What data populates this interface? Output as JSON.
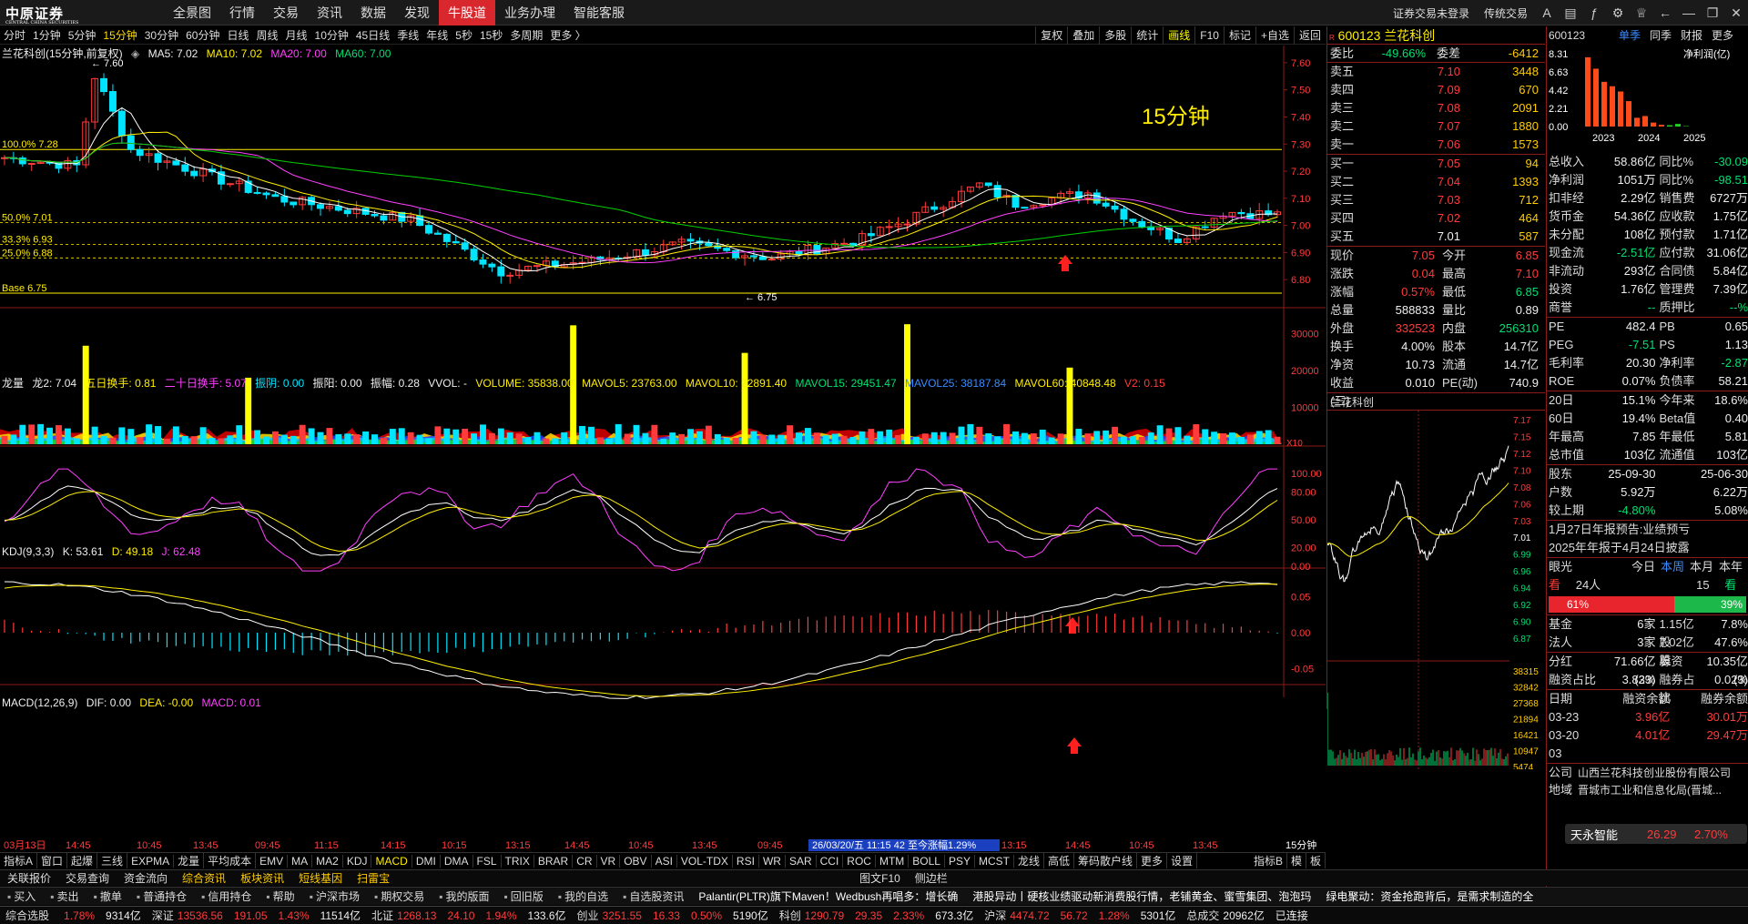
{
  "brand": {
    "name": "中原证券",
    "sub": "CENTRAL CHINA SECURITIES"
  },
  "menu": [
    "全景图",
    "行情",
    "交易",
    "资讯",
    "数据",
    "发现",
    "牛股道",
    "业务办理",
    "智能客服"
  ],
  "menu_active": 6,
  "topright": {
    "login": "证券交易未登录",
    "trad": "传统交易"
  },
  "periods": [
    "分时",
    "1分钟",
    "5分钟",
    "15分钟",
    "30分钟",
    "60分钟",
    "日线",
    "周线",
    "月线",
    "10分钟",
    "45日线",
    "季线",
    "年线",
    "5秒",
    "15秒",
    "多周期",
    "更多 〉"
  ],
  "period_active": 3,
  "chart_tools": [
    "复权",
    "叠加",
    "多股",
    "统计",
    "画线",
    "F10",
    "标记",
    "+自选",
    "返回"
  ],
  "main_legend": {
    "name": "兰花科创(15分钟,前复权)",
    "ma5": "MA5: 7.02",
    "ma10": "MA10: 7.02",
    "ma20": "MA20: 7.00",
    "ma60": "MA60: 7.00"
  },
  "period_label": "15分钟",
  "price_axis": [
    "7.60",
    "7.50",
    "7.40",
    "7.30",
    "7.20",
    "7.10",
    "7.00",
    "6.90",
    "6.80"
  ],
  "fib_levels": [
    {
      "label": "100.0% 7.28",
      "v": 7.28
    },
    {
      "label": "50.0% 7.01",
      "v": 7.01
    },
    {
      "label": "33.3% 6.93",
      "v": 6.93
    },
    {
      "label": "25.0% 6.88",
      "v": 6.88
    },
    {
      "label": "Base 6.75",
      "v": 6.75
    }
  ],
  "hi_label": "7.60",
  "lo_label": "6.75",
  "vol_legend": {
    "name": "龙量",
    "l2": "龙2: 7.04",
    "t5": "五日换手: 0.81",
    "t20": "二十日换手: 5.07",
    "zy": "振阴: 0.00",
    "zh": "振阳: 0.00",
    "zf": "振幅: 0.28",
    "vvol": "VVOL: -",
    "vol": "VOLUME: 35838.00",
    "mv5": "MAVOL5: 23763.00",
    "mv10": "MAVOL10: 22891.40",
    "mv15": "MAVOL15: 29451.47",
    "mv25": "MAVOL25: 38187.84",
    "mv60": "MAVOL60: 40848.48",
    "v2": "V2: 0.15"
  },
  "vol_axis": [
    "30000",
    "20000",
    "10000"
  ],
  "vol_unit": "X10",
  "kdj_legend": {
    "name": "KDJ(9,3,3)",
    "k": "K: 53.61",
    "d": "D: 49.18",
    "j": "J: 62.48"
  },
  "kdj_axis": [
    "100.00",
    "80.00",
    "50.00",
    "20.00",
    "0.00"
  ],
  "macd_legend": {
    "name": "MACD(12,26,9)",
    "dif": "DIF: 0.00",
    "dea": "DEA: -0.00",
    "macd": "MACD: 0.01"
  },
  "macd_axis": [
    "0.05",
    "0.00",
    "-0.05"
  ],
  "time_axis": [
    "03月13日",
    "14:45",
    "10:45",
    "13:45",
    "09:45",
    "11:15",
    "14:15",
    "10:15",
    "13:15",
    "14:45",
    "10:45",
    "13:45",
    "09:45",
    "26/03/20/五 11:15 42 至今涨幅1.29%",
    "13:15",
    "14:45",
    "10:45",
    "13:45"
  ],
  "axis_period": "15分钟",
  "bottom_tabs": [
    "指标A",
    "窗口",
    "起爆",
    "三线",
    "EXPMA",
    "龙量",
    "平均成本",
    "EMV",
    "MA",
    "MA2",
    "KDJ",
    "MACD",
    "DMI",
    "DMA",
    "FSL",
    "TRIX",
    "BRAR",
    "CR",
    "VR",
    "OBV",
    "ASI",
    "VOL-TDX",
    "RSI",
    "WR",
    "SAR",
    "CCI",
    "ROC",
    "MTM",
    "BOLL",
    "PSY",
    "MCST",
    "龙线",
    "高低",
    "筹码散户线",
    "更多",
    "设置"
  ],
  "bottom_tab_active": 11,
  "bottom_right_tabs": [
    "指标B",
    "模",
    "板"
  ],
  "quote": {
    "code": "600123",
    "name": "兰花科创",
    "wb": "委比",
    "wb_v": "-49.66%",
    "wc": "委差",
    "wc_v": "-6412",
    "asks": [
      {
        "l": "卖五",
        "p": "7.10",
        "v": "3448"
      },
      {
        "l": "卖四",
        "p": "7.09",
        "v": "670"
      },
      {
        "l": "卖三",
        "p": "7.08",
        "v": "2091"
      },
      {
        "l": "卖二",
        "p": "7.07",
        "v": "1880"
      },
      {
        "l": "卖一",
        "p": "7.06",
        "v": "1573"
      }
    ],
    "bids": [
      {
        "l": "买一",
        "p": "7.05",
        "v": "94"
      },
      {
        "l": "买二",
        "p": "7.04",
        "v": "1393"
      },
      {
        "l": "买三",
        "p": "7.03",
        "v": "712"
      },
      {
        "l": "买四",
        "p": "7.02",
        "v": "464"
      },
      {
        "l": "买五",
        "p": "7.01",
        "v": "587"
      }
    ],
    "stats": [
      [
        "现价",
        "7.05",
        "今开",
        "6.85"
      ],
      [
        "涨跌",
        "0.04",
        "最高",
        "7.10"
      ],
      [
        "涨幅",
        "0.57%",
        "最低",
        "6.85"
      ],
      [
        "总量",
        "588833",
        "量比",
        "0.89"
      ],
      [
        "外盘",
        "332523",
        "内盘",
        "256310"
      ],
      [
        "换手",
        "4.00%",
        "股本",
        "14.7亿"
      ],
      [
        "净资",
        "10.73",
        "流通",
        "14.7亿"
      ],
      [
        "收益(三)",
        "0.010",
        "PE(动)",
        "740.9"
      ]
    ],
    "mini_title": "兰花科创",
    "mini_axis": [
      "7.17",
      "7.15",
      "7.12",
      "7.10",
      "7.08",
      "7.06",
      "7.03",
      "7.01",
      "6.99",
      "6.96",
      "6.94",
      "6.92",
      "6.90",
      "6.87"
    ],
    "mini_vol": [
      "38315",
      "32842",
      "27368",
      "21894",
      "16421",
      "10947",
      "5474"
    ]
  },
  "fin": {
    "code": "600123",
    "tabs": [
      "单季",
      "同季",
      "财报",
      "更多"
    ],
    "chart_title": "净利润(亿)",
    "chart_axis": [
      "8.31",
      "6.63",
      "4.42",
      "2.21",
      "0.00"
    ],
    "years": [
      "2023",
      "2024",
      "2025"
    ],
    "bars": [
      7.9,
      6.6,
      5.1,
      4.6,
      4.0,
      2.9,
      1.0,
      1.2,
      0.45,
      0.2,
      0.15,
      0.3,
      0.05
    ],
    "rows": [
      [
        "总收入",
        "58.86亿",
        "同比%",
        "-30.09"
      ],
      [
        "净利润",
        "1051万",
        "同比%",
        "-98.51"
      ],
      [
        "扣非经",
        "2.29亿",
        "销售费",
        "6727万"
      ],
      [
        "货币金",
        "54.36亿",
        "应收款",
        "1.75亿"
      ],
      [
        "未分配",
        "108亿",
        "预付款",
        "1.71亿"
      ],
      [
        "现金流",
        "-2.51亿",
        "应付款",
        "31.06亿"
      ],
      [
        "非流动",
        "293亿",
        "合同债",
        "5.84亿"
      ],
      [
        "投资",
        "1.76亿",
        "管理费",
        "7.39亿"
      ],
      [
        "商誉",
        "--",
        "质押比",
        "--%"
      ]
    ],
    "rows2": [
      [
        "PE",
        "482.4",
        "PB",
        "0.65"
      ],
      [
        "PEG",
        "-7.51",
        "PS",
        "1.13"
      ],
      [
        "毛利率",
        "20.30",
        "净利率",
        "-2.87"
      ],
      [
        "ROE",
        "0.07%",
        "负债率",
        "58.21"
      ]
    ],
    "rows3": [
      [
        "20日",
        "15.1%",
        "今年来",
        "18.6%"
      ],
      [
        "60日",
        "19.4%",
        "Beta值",
        "0.40"
      ],
      [
        "年最高",
        "7.85",
        "年最低",
        "5.81"
      ],
      [
        "总市值",
        "103亿",
        "流通值",
        "103亿"
      ]
    ],
    "rows4": [
      [
        "股东",
        "25-09-30",
        "",
        "25-06-30"
      ],
      [
        "户数",
        "5.92万",
        "",
        "6.22万"
      ],
      [
        "较上期",
        "-4.80%",
        "",
        "5.08%"
      ]
    ],
    "notice1": "1月27日年报预告:业绩预亏",
    "notice2": "2025年年报于4月24日披露",
    "eye": {
      "label": "眼光",
      "tabs": [
        "今日",
        "本周",
        "本月",
        "本年"
      ],
      "bull": "看多",
      "bull_n": "24人",
      "bear": "15人",
      "bear_t": "看空",
      "bull_pct": "61%",
      "bear_pct": "39%"
    },
    "inst": [
      [
        "基金",
        "6家",
        "1.15亿股",
        "7.8%"
      ],
      [
        "法人",
        "3家",
        "7.02亿股",
        "47.6%"
      ]
    ],
    "fh": [
      [
        "分红",
        "71.66亿(23)",
        "募资",
        "10.35亿(3)"
      ],
      [
        "融资占比",
        "3.83%",
        "融券占比",
        "0.02%"
      ]
    ],
    "margin_head": [
      "日期",
      "融资余额",
      "融券余额"
    ],
    "margin": [
      [
        "03-23",
        "3.96亿",
        "30.01万"
      ],
      [
        "03-20",
        "4.01亿",
        "29.47万"
      ],
      [
        "03",
        "",
        " "
      ]
    ],
    "company_k": "公司",
    "company": "山西兰花科技创业股份有限公司",
    "region_k": "地域",
    "region": "晋城市工业和信息化局(晋城...",
    "ai": {
      "label": "天永智能",
      "v1": "26.29",
      "v2": "2.70%"
    }
  },
  "rq_tabs": [
    "笔",
    "价",
    "细",
    "势",
    "联",
    "值",
    "主",
    "逆",
    "筹"
  ],
  "toolbar2": [
    "关联报价",
    "交易查询",
    "资金流向",
    "综合资讯",
    "板块资讯",
    "短线基因",
    "扫雷宝"
  ],
  "toolbar2_right": [
    "图文F10",
    "侧边栏"
  ],
  "toolbar3": [
    "买入",
    "卖出",
    "撤单",
    "普通持仓",
    "信用持仓",
    "帮助",
    "沪深市场",
    "期权交易",
    "我的版面",
    "回旧版",
    "我的自选",
    "自选股资讯"
  ],
  "news": "Palantir(PLTR)旗下Maven！Wedbush再唱多：增长确",
  "news2": "港股异动丨硬核业绩驱动新消费股行情，老铺黄金、蜜雪集团、泡泡玛",
  "news3": "绿电聚动：资金抢跑背后，是需求制造的全",
  "status": [
    {
      "k": "综合选股",
      "v": ""
    },
    {
      "k": "",
      "v": "1.78%",
      "c": "red"
    },
    {
      "k": "",
      "v": "9314亿",
      "c": "white"
    },
    {
      "k": "深证",
      "v": "13536.56",
      "c": "red"
    },
    {
      "k": "",
      "v": "191.05",
      "c": "red"
    },
    {
      "k": "",
      "v": "1.43%",
      "c": "red"
    },
    {
      "k": "",
      "v": "11514亿",
      "c": "white"
    },
    {
      "k": "北证",
      "v": "1268.13",
      "c": "red"
    },
    {
      "k": "",
      "v": "24.10",
      "c": "red"
    },
    {
      "k": "",
      "v": "1.94%",
      "c": "red"
    },
    {
      "k": "",
      "v": "133.6亿",
      "c": "white"
    },
    {
      "k": "创业",
      "v": "3251.55",
      "c": "red"
    },
    {
      "k": "",
      "v": "16.33",
      "c": "red"
    },
    {
      "k": "",
      "v": "0.50%",
      "c": "red"
    },
    {
      "k": "",
      "v": "5190亿",
      "c": "white"
    },
    {
      "k": "科创",
      "v": "1290.79",
      "c": "red"
    },
    {
      "k": "",
      "v": "29.35",
      "c": "red"
    },
    {
      "k": "",
      "v": "2.33%",
      "c": "red"
    },
    {
      "k": "",
      "v": "673.3亿",
      "c": "white"
    },
    {
      "k": "沪深",
      "v": "4474.72",
      "c": "red"
    },
    {
      "k": "",
      "v": "56.72",
      "c": "red"
    },
    {
      "k": "",
      "v": "1.28%",
      "c": "red"
    },
    {
      "k": "",
      "v": "5301亿",
      "c": "white"
    },
    {
      "k": "总成交",
      "v": "20962亿",
      "c": "white"
    },
    {
      "k": "",
      "v": "已连接",
      "c": "white"
    }
  ],
  "colors": {
    "up": "#ff3b3b",
    "down": "#00e5ff",
    "ma5": "#ffffff",
    "ma10": "#ffee00",
    "ma20": "#ff40ff",
    "ma60": "#00d000"
  }
}
